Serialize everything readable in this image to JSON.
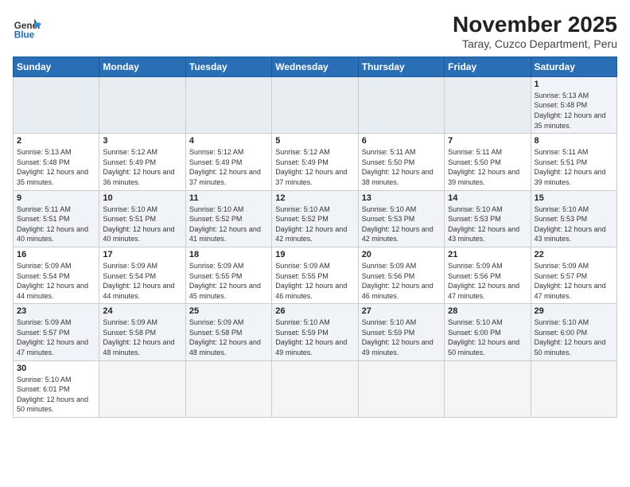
{
  "header": {
    "logo_general": "General",
    "logo_blue": "Blue",
    "month_title": "November 2025",
    "subtitle": "Taray, Cuzco Department, Peru"
  },
  "days_of_week": [
    "Sunday",
    "Monday",
    "Tuesday",
    "Wednesday",
    "Thursday",
    "Friday",
    "Saturday"
  ],
  "weeks": [
    [
      {
        "day": "",
        "info": ""
      },
      {
        "day": "",
        "info": ""
      },
      {
        "day": "",
        "info": ""
      },
      {
        "day": "",
        "info": ""
      },
      {
        "day": "",
        "info": ""
      },
      {
        "day": "",
        "info": ""
      },
      {
        "day": "1",
        "info": "Sunrise: 5:13 AM\nSunset: 5:48 PM\nDaylight: 12 hours\nand 35 minutes."
      }
    ],
    [
      {
        "day": "2",
        "info": "Sunrise: 5:13 AM\nSunset: 5:48 PM\nDaylight: 12 hours\nand 35 minutes."
      },
      {
        "day": "3",
        "info": "Sunrise: 5:12 AM\nSunset: 5:49 PM\nDaylight: 12 hours\nand 36 minutes."
      },
      {
        "day": "4",
        "info": "Sunrise: 5:12 AM\nSunset: 5:49 PM\nDaylight: 12 hours\nand 37 minutes."
      },
      {
        "day": "5",
        "info": "Sunrise: 5:12 AM\nSunset: 5:49 PM\nDaylight: 12 hours\nand 37 minutes."
      },
      {
        "day": "6",
        "info": "Sunrise: 5:11 AM\nSunset: 5:50 PM\nDaylight: 12 hours\nand 38 minutes."
      },
      {
        "day": "7",
        "info": "Sunrise: 5:11 AM\nSunset: 5:50 PM\nDaylight: 12 hours\nand 39 minutes."
      },
      {
        "day": "8",
        "info": "Sunrise: 5:11 AM\nSunset: 5:51 PM\nDaylight: 12 hours\nand 39 minutes."
      }
    ],
    [
      {
        "day": "9",
        "info": "Sunrise: 5:11 AM\nSunset: 5:51 PM\nDaylight: 12 hours\nand 40 minutes."
      },
      {
        "day": "10",
        "info": "Sunrise: 5:10 AM\nSunset: 5:51 PM\nDaylight: 12 hours\nand 40 minutes."
      },
      {
        "day": "11",
        "info": "Sunrise: 5:10 AM\nSunset: 5:52 PM\nDaylight: 12 hours\nand 41 minutes."
      },
      {
        "day": "12",
        "info": "Sunrise: 5:10 AM\nSunset: 5:52 PM\nDaylight: 12 hours\nand 42 minutes."
      },
      {
        "day": "13",
        "info": "Sunrise: 5:10 AM\nSunset: 5:53 PM\nDaylight: 12 hours\nand 42 minutes."
      },
      {
        "day": "14",
        "info": "Sunrise: 5:10 AM\nSunset: 5:53 PM\nDaylight: 12 hours\nand 43 minutes."
      },
      {
        "day": "15",
        "info": "Sunrise: 5:10 AM\nSunset: 5:53 PM\nDaylight: 12 hours\nand 43 minutes."
      }
    ],
    [
      {
        "day": "16",
        "info": "Sunrise: 5:09 AM\nSunset: 5:54 PM\nDaylight: 12 hours\nand 44 minutes."
      },
      {
        "day": "17",
        "info": "Sunrise: 5:09 AM\nSunset: 5:54 PM\nDaylight: 12 hours\nand 44 minutes."
      },
      {
        "day": "18",
        "info": "Sunrise: 5:09 AM\nSunset: 5:55 PM\nDaylight: 12 hours\nand 45 minutes."
      },
      {
        "day": "19",
        "info": "Sunrise: 5:09 AM\nSunset: 5:55 PM\nDaylight: 12 hours\nand 46 minutes."
      },
      {
        "day": "20",
        "info": "Sunrise: 5:09 AM\nSunset: 5:56 PM\nDaylight: 12 hours\nand 46 minutes."
      },
      {
        "day": "21",
        "info": "Sunrise: 5:09 AM\nSunset: 5:56 PM\nDaylight: 12 hours\nand 47 minutes."
      },
      {
        "day": "22",
        "info": "Sunrise: 5:09 AM\nSunset: 5:57 PM\nDaylight: 12 hours\nand 47 minutes."
      }
    ],
    [
      {
        "day": "23",
        "info": "Sunrise: 5:09 AM\nSunset: 5:57 PM\nDaylight: 12 hours\nand 47 minutes."
      },
      {
        "day": "24",
        "info": "Sunrise: 5:09 AM\nSunset: 5:58 PM\nDaylight: 12 hours\nand 48 minutes."
      },
      {
        "day": "25",
        "info": "Sunrise: 5:09 AM\nSunset: 5:58 PM\nDaylight: 12 hours\nand 48 minutes."
      },
      {
        "day": "26",
        "info": "Sunrise: 5:10 AM\nSunset: 5:59 PM\nDaylight: 12 hours\nand 49 minutes."
      },
      {
        "day": "27",
        "info": "Sunrise: 5:10 AM\nSunset: 5:59 PM\nDaylight: 12 hours\nand 49 minutes."
      },
      {
        "day": "28",
        "info": "Sunrise: 5:10 AM\nSunset: 6:00 PM\nDaylight: 12 hours\nand 50 minutes."
      },
      {
        "day": "29",
        "info": "Sunrise: 5:10 AM\nSunset: 6:00 PM\nDaylight: 12 hours\nand 50 minutes."
      }
    ],
    [
      {
        "day": "30",
        "info": "Sunrise: 5:10 AM\nSunset: 6:01 PM\nDaylight: 12 hours\nand 50 minutes."
      },
      {
        "day": "",
        "info": ""
      },
      {
        "day": "",
        "info": ""
      },
      {
        "day": "",
        "info": ""
      },
      {
        "day": "",
        "info": ""
      },
      {
        "day": "",
        "info": ""
      },
      {
        "day": "",
        "info": ""
      }
    ]
  ]
}
